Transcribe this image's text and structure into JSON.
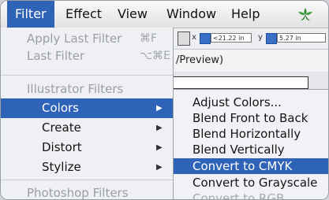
{
  "menubar": {
    "items": [
      {
        "label": "Filter",
        "active": true
      },
      {
        "label": "Effect"
      },
      {
        "label": "View"
      },
      {
        "label": "Window"
      },
      {
        "label": "Help"
      }
    ],
    "logo_icon": "illustrator-flower-icon"
  },
  "toolbar": {
    "field1": "<21.22 in",
    "field2": "5.27 in"
  },
  "document": {
    "title": "/Preview)"
  },
  "filter_menu": {
    "items": [
      {
        "label": "Apply Last Filter",
        "shortcut": "⌘F",
        "disabled": true
      },
      {
        "label": "Last Filter",
        "shortcut": "⌥⌘E",
        "disabled": true
      },
      {
        "label": "Illustrator Filters",
        "disabled": true
      },
      {
        "label": "Colors",
        "highlighted": true,
        "submenu": true
      },
      {
        "label": "Create",
        "submenu": true
      },
      {
        "label": "Distort",
        "submenu": true
      },
      {
        "label": "Stylize",
        "submenu": true
      },
      {
        "label": "Photoshop Filters",
        "disabled": true
      }
    ]
  },
  "colors_submenu": {
    "items": [
      {
        "label": "Adjust Colors..."
      },
      {
        "label": "Blend Front to Back"
      },
      {
        "label": "Blend Horizontally"
      },
      {
        "label": "Blend Vertically"
      },
      {
        "label": "Convert to CMYK",
        "highlighted": true
      },
      {
        "label": "Convert to Grayscale"
      },
      {
        "label": "Convert to RGB",
        "disabled": true
      }
    ]
  },
  "colors": {
    "highlight": "#2f63b8",
    "menu_bg": "#eef0f3",
    "disabled_text": "#9b9ea4"
  }
}
